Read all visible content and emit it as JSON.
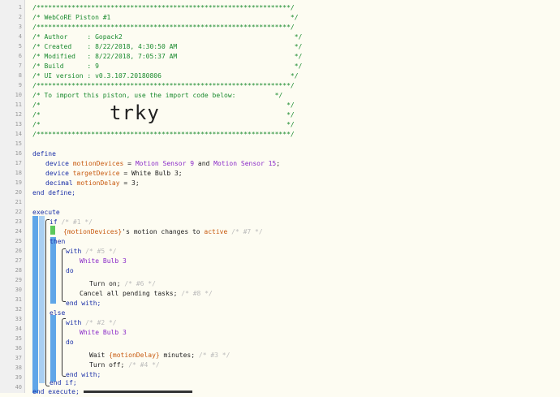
{
  "line_numbers": [
    "1",
    "2",
    "3",
    "4",
    "5",
    "6",
    "7",
    "8",
    "9",
    "10",
    "11",
    "12",
    "13",
    "14",
    "15",
    "16",
    "17",
    "18",
    "19",
    "20",
    "21",
    "22",
    "23",
    "24",
    "25",
    "26",
    "27",
    "28",
    "29",
    "30",
    "31",
    "32",
    "33",
    "34",
    "35",
    "36",
    "37",
    "38",
    "39",
    "40"
  ],
  "header": {
    "border": "/*****************************************************************/",
    "title": "/* WebCoRE Piston #1                                              */",
    "author": "/* Author     : Gopack2                                            */",
    "created": "/* Created    : 8/22/2018, 4:30:50 AM                              */",
    "modified": "/* Modified   : 8/22/2018, 7:05:37 AM                              */",
    "build": "/* Build      : 9                                                  */",
    "ui_version": "/* UI version : v0.3.107.20180806                                 */",
    "import_note": "/* To import this piston, use the import code below:          */",
    "blank": "/*                                                               */",
    "import_code": "trky"
  },
  "code": {
    "define": "define",
    "device_kw": "device",
    "motion_devices": "motionDevices",
    "eq": " = ",
    "motion_sensor_9": "Motion Sensor 9",
    "and": " and ",
    "motion_sensor_15": "Motion Sensor 15",
    "semi": ";",
    "target_device": "targetDevice",
    "white_bulb_3_decl": "White Bulb 3",
    "decimal_kw": "decimal",
    "motion_delay": "motionDelay",
    "three": "3",
    "end_define": "end define;",
    "execute": "execute",
    "if": "if",
    "c1": "/* #1 */",
    "cond_devices": "{motionDevices}",
    "cond_mid": "'s motion changes to ",
    "active": "active",
    "c7": "/* #7 */",
    "then": "then",
    "with1": "with",
    "c5": "/* #5 */",
    "white_bulb_3_a": "White Bulb 3",
    "do1": "do",
    "turn_on": "Turn on;",
    "c6": "/* #6 */",
    "cancel_tasks": "Cancel all pending tasks;",
    "c8": "/* #8 */",
    "end_with1": "end with;",
    "else": "else",
    "with2": "with",
    "c2": "/* #2 */",
    "white_bulb_3_b": "White Bulb 3",
    "do2": "do",
    "wait": "Wait ",
    "wait_var": "{motionDelay}",
    "wait_unit": " minutes;",
    "c3": "/* #3 */",
    "turn_off": "Turn off;",
    "c4": "/* #4 */",
    "end_with2": "end with;",
    "end_if": "end if;",
    "end_execute": "end execute;"
  }
}
